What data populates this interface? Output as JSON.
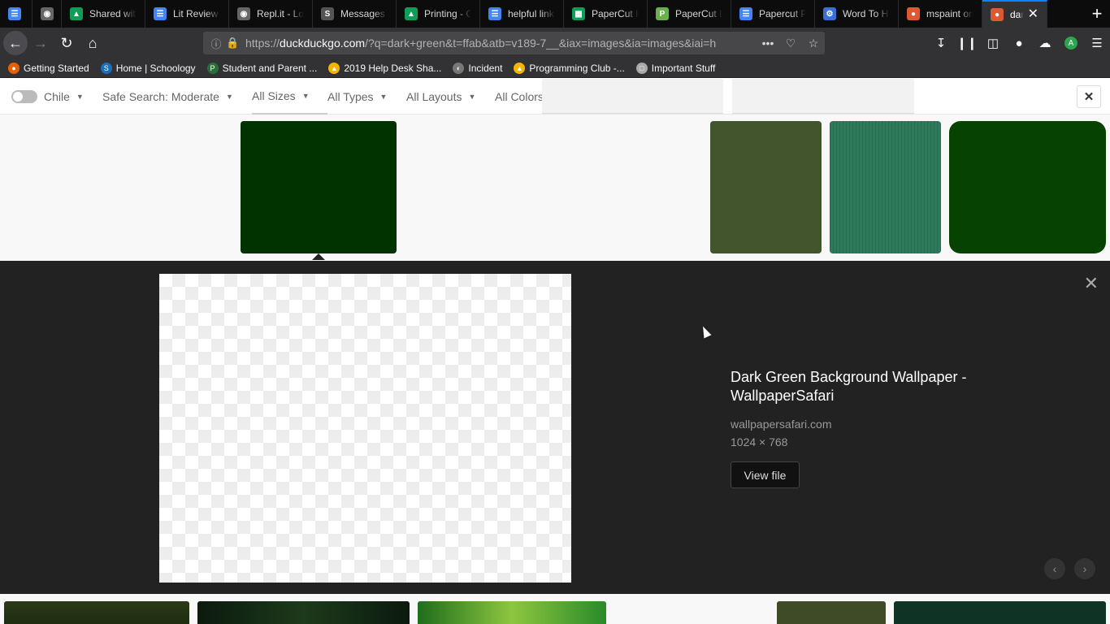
{
  "browser": {
    "tabs": [
      {
        "label": "",
        "icon": "docs-icon",
        "color": "#4285f4"
      },
      {
        "label": "",
        "icon": "circle-app-icon",
        "color": "#666"
      },
      {
        "label": "Shared with",
        "icon": "drive-icon",
        "color": "#0f9d58"
      },
      {
        "label": "Lit Review -",
        "icon": "docs-icon",
        "color": "#4285f4"
      },
      {
        "label": "Repl.it - Log",
        "icon": "replit-icon",
        "color": "#666"
      },
      {
        "label": "Messages |",
        "icon": "schoology-icon",
        "color": "#555"
      },
      {
        "label": "Printing - Go",
        "icon": "drive-icon",
        "color": "#0f9d58"
      },
      {
        "label": "helpful links",
        "icon": "docs-icon",
        "color": "#4285f4"
      },
      {
        "label": "PaperCut Pr",
        "icon": "sheets-icon",
        "color": "#0f9d58"
      },
      {
        "label": "PaperCut Lo",
        "icon": "papercut-icon",
        "color": "#6ab04c"
      },
      {
        "label": "Papercut Pr",
        "icon": "docs-icon",
        "color": "#4285f4"
      },
      {
        "label": "Word To HT",
        "icon": "gear-icon",
        "color": "#3a6fd8"
      },
      {
        "label": "mspaint onl",
        "icon": "duckduckgo-icon",
        "color": "#de5833"
      },
      {
        "label": "dark gre",
        "icon": "duckduckgo-icon",
        "color": "#de5833",
        "active": true
      }
    ],
    "url_prefix": "https://",
    "url_domain": "duckduckgo.com",
    "url_rest": "/?q=dark+green&t=ffab&atb=v189-7__&iax=images&ia=images&iai=h",
    "bookmarks": [
      {
        "label": "Getting Started",
        "icon": "firefox-icon",
        "color": "#e66000"
      },
      {
        "label": "Home | Schoology",
        "icon": "schoology-icon",
        "color": "#1a70b8"
      },
      {
        "label": "Student and Parent ...",
        "icon": "p-icon",
        "color": "#2a6f3a"
      },
      {
        "label": "2019 Help Desk Sha...",
        "icon": "drive-icon",
        "color": "#f4b400"
      },
      {
        "label": "Incident",
        "icon": "globe-icon",
        "color": "#777"
      },
      {
        "label": "Programming Club -...",
        "icon": "drive-icon",
        "color": "#f4b400"
      },
      {
        "label": "Important Stuff",
        "icon": "folder-icon",
        "color": "#aaa"
      }
    ],
    "account_initial": "A"
  },
  "filters": {
    "region": "Chile",
    "safe_search": "Safe Search: Moderate",
    "size": "All Sizes",
    "type": "All Types",
    "layout": "All Layouts",
    "color": "All Colors"
  },
  "thumbnails": {
    "colors": [
      "#003300",
      "#42552d",
      "#2f7a5a",
      "#064300"
    ]
  },
  "detail": {
    "title": "Dark Green Background Wallpaper - WallpaperSafari",
    "source": "wallpapersafari.com",
    "dimensions": "1024 × 768",
    "view_file": "View file"
  }
}
